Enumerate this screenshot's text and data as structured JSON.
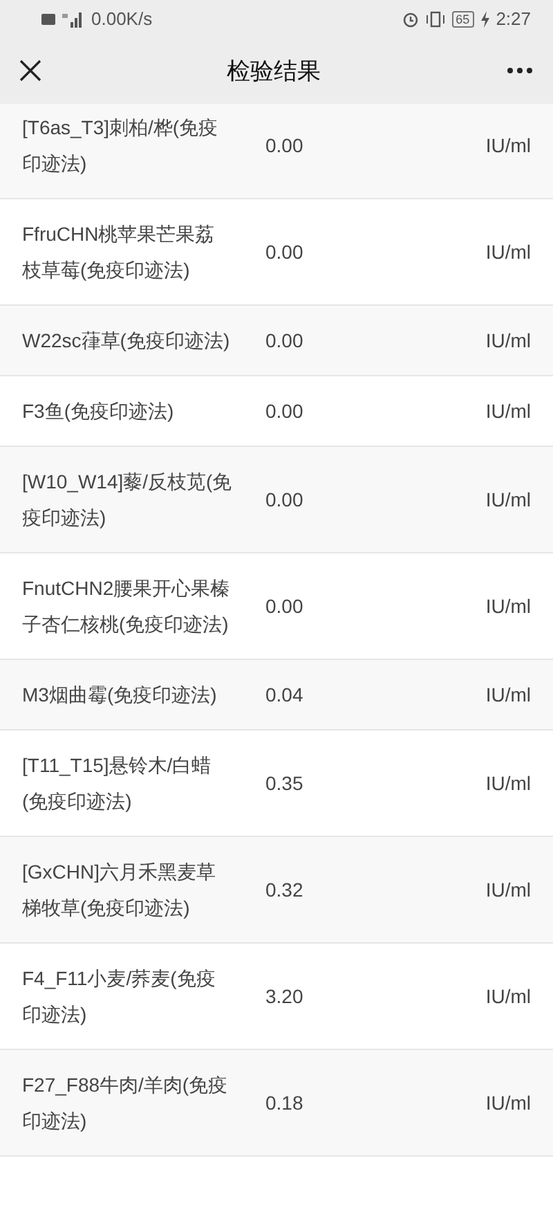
{
  "status_bar": {
    "network_speed": "0.00K/s",
    "battery": "65",
    "time": "2:27"
  },
  "header": {
    "title": "检验结果"
  },
  "results": [
    {
      "name": "[T6as_T3]刺柏/桦(免疫印迹法)",
      "value": "0.00",
      "unit": "IU/ml"
    },
    {
      "name": "FfruCHN桃苹果芒果荔枝草莓(免疫印迹法)",
      "value": "0.00",
      "unit": "IU/ml"
    },
    {
      "name": "W22sc葎草(免疫印迹法)",
      "value": "0.00",
      "unit": "IU/ml"
    },
    {
      "name": "F3鱼(免疫印迹法)",
      "value": "0.00",
      "unit": "IU/ml"
    },
    {
      "name": "[W10_W14]藜/反枝苋(免疫印迹法)",
      "value": "0.00",
      "unit": "IU/ml"
    },
    {
      "name": "FnutCHN2腰果开心果榛子杏仁核桃(免疫印迹法)",
      "value": "0.00",
      "unit": "IU/ml"
    },
    {
      "name": "M3烟曲霉(免疫印迹法)",
      "value": "0.04",
      "unit": "IU/ml"
    },
    {
      "name": "[T11_T15]悬铃木/白蜡(免疫印迹法)",
      "value": "0.35",
      "unit": "IU/ml"
    },
    {
      "name": "[GxCHN]六月禾黑麦草梯牧草(免疫印迹法)",
      "value": "0.32",
      "unit": "IU/ml"
    },
    {
      "name": "F4_F11小麦/荞麦(免疫印迹法)",
      "value": "3.20",
      "unit": "IU/ml"
    },
    {
      "name": "F27_F88牛肉/羊肉(免疫印迹法)",
      "value": "0.18",
      "unit": "IU/ml"
    }
  ]
}
